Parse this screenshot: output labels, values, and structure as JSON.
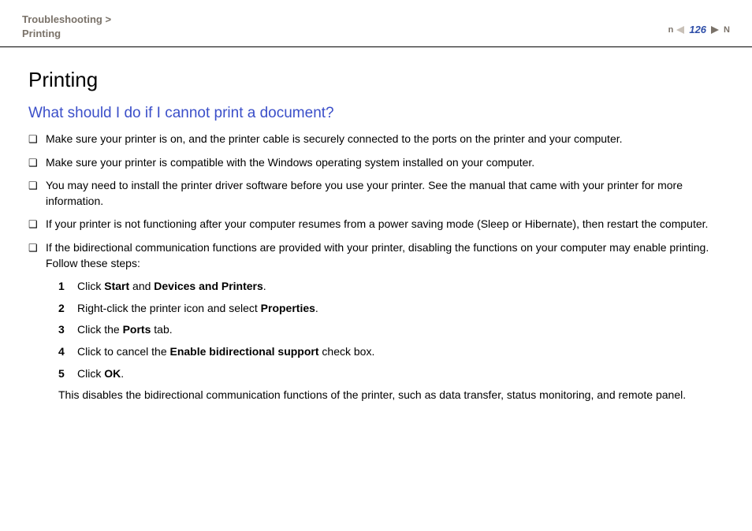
{
  "breadcrumb": {
    "parent": "Troubleshooting",
    "sep": ">",
    "current": "Printing"
  },
  "pageNav": {
    "number": "126",
    "n": "n",
    "N": "N"
  },
  "title": "Printing",
  "question": "What should I do if I cannot print a document?",
  "bullets": [
    "Make sure your printer is on, and the printer cable is securely connected to the ports on the printer and your computer.",
    "Make sure your printer is compatible with the Windows operating system installed on your computer.",
    "You may need to install the printer driver software before you use your printer. See the manual that came with your printer for more information.",
    "If your printer is not functioning after your computer resumes from a power saving mode (Sleep or Hibernate), then restart the computer.",
    "If the bidirectional communication functions are provided with your printer, disabling the functions on your computer may enable printing. Follow these steps:"
  ],
  "steps": {
    "s1": {
      "num": "1",
      "pre": "Click ",
      "b1": "Start",
      "mid": " and ",
      "b2": "Devices and Printers",
      "post": "."
    },
    "s2": {
      "num": "2",
      "pre": "Right-click the printer icon and select ",
      "b1": "Properties",
      "post": "."
    },
    "s3": {
      "num": "3",
      "pre": "Click the ",
      "b1": "Ports",
      "post": " tab."
    },
    "s4": {
      "num": "4",
      "pre": "Click to cancel the ",
      "b1": "Enable bidirectional support",
      "post": " check box."
    },
    "s5": {
      "num": "5",
      "pre": "Click ",
      "b1": "OK",
      "post": "."
    }
  },
  "closing": "This disables the bidirectional communication functions of the printer, such as data transfer, status monitoring, and remote panel."
}
